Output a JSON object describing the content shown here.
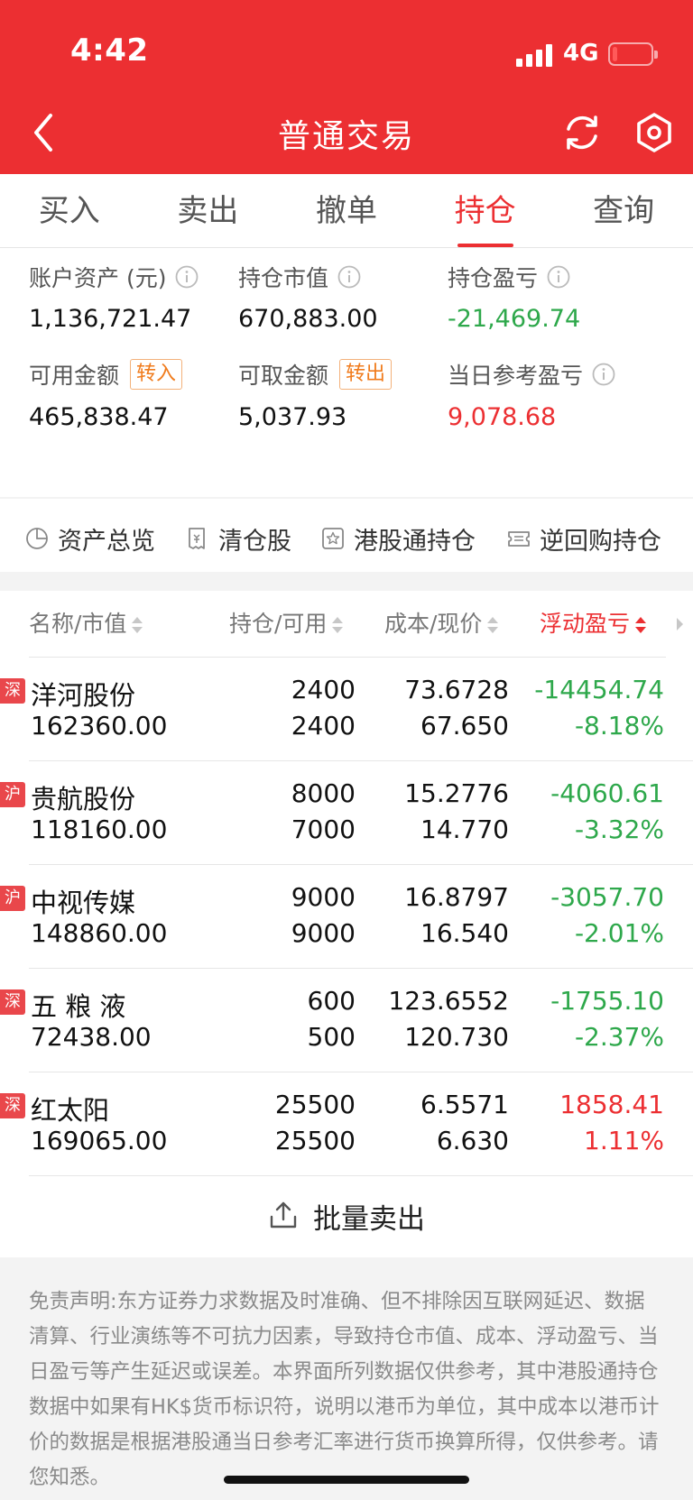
{
  "status_bar": {
    "time": "4:42",
    "network": "4G"
  },
  "nav": {
    "title": "普通交易"
  },
  "tabs": [
    {
      "label": "买入",
      "active": false
    },
    {
      "label": "卖出",
      "active": false
    },
    {
      "label": "撤单",
      "active": false
    },
    {
      "label": "持仓",
      "active": true
    },
    {
      "label": "查询",
      "active": false
    }
  ],
  "summary": {
    "total_assets_label": "账户资产 (元)",
    "total_assets_value": "1,136,721.47",
    "market_value_label": "持仓市值",
    "market_value_value": "670,883.00",
    "position_pl_label": "持仓盈亏",
    "position_pl_value": "-21,469.74",
    "available_label": "可用金额",
    "available_chip": "转入",
    "available_value": "465,838.47",
    "withdrawable_label": "可取金额",
    "withdrawable_chip": "转出",
    "withdrawable_value": "5,037.93",
    "daily_pl_label": "当日参考盈亏",
    "daily_pl_value": "9,078.68"
  },
  "shortcuts": [
    {
      "label": "资产总览",
      "icon": "pie-chart-icon"
    },
    {
      "label": "清仓股",
      "icon": "receipt-icon"
    },
    {
      "label": "港股通持仓",
      "icon": "star-box-icon"
    },
    {
      "label": "逆回购持仓",
      "icon": "ticket-icon"
    }
  ],
  "table": {
    "headers": {
      "name": "名称/市值",
      "position": "持仓/可用",
      "cost": "成本/现价",
      "pl": "浮动盈亏"
    },
    "rows": [
      {
        "market": "深",
        "name": "洋河股份",
        "market_value": "162360.00",
        "qty": "2400",
        "available": "2400",
        "cost": "73.6728",
        "price": "67.650",
        "pl": "-14454.74",
        "pct": "-8.18%",
        "sign": "neg"
      },
      {
        "market": "沪",
        "name": "贵航股份",
        "market_value": "118160.00",
        "qty": "8000",
        "available": "7000",
        "cost": "15.2776",
        "price": "14.770",
        "pl": "-4060.61",
        "pct": "-3.32%",
        "sign": "neg"
      },
      {
        "market": "沪",
        "name": "中视传媒",
        "market_value": "148860.00",
        "qty": "9000",
        "available": "9000",
        "cost": "16.8797",
        "price": "16.540",
        "pl": "-3057.70",
        "pct": "-2.01%",
        "sign": "neg"
      },
      {
        "market": "深",
        "name": "五 粮 液",
        "market_value": "72438.00",
        "qty": "600",
        "available": "500",
        "cost": "123.6552",
        "price": "120.730",
        "pl": "-1755.10",
        "pct": "-2.37%",
        "sign": "neg"
      },
      {
        "market": "深",
        "name": "红太阳",
        "market_value": "169065.00",
        "qty": "25500",
        "available": "25500",
        "cost": "6.5571",
        "price": "6.630",
        "pl": "1858.41",
        "pct": "1.11%",
        "sign": "pos"
      }
    ]
  },
  "batch_sell": {
    "label": "批量卖出"
  },
  "disclaimer": "免责声明:东方证券力求数据及时准确、但不排除因互联网延迟、数据清算、行业演练等不可抗力因素，导致持仓市值、成本、浮动盈亏、当日盈亏等产生延迟或误差。本界面所列数据仅供参考，其中港股通持仓数据中如果有HK$货币标识符，说明以港币为单位，其中成本以港币计价的数据是根据港股通当日参考汇率进行货币换算所得，仅供参考。请您知悉。",
  "colors": {
    "brand_red": "#ec2f32",
    "loss_green": "#2ea84b",
    "chip_orange": "#f07b1c"
  }
}
